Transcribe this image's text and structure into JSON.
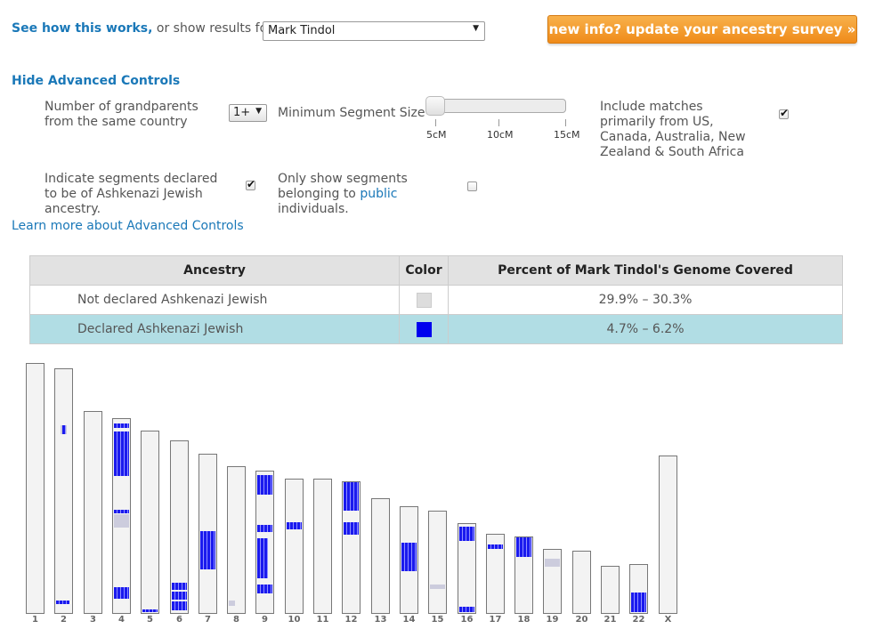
{
  "header": {
    "see_how": "See how this works,",
    "or_text": " or show results for",
    "selected_person": "Mark Tindol",
    "update_button": "new info? update your ancestry survey »"
  },
  "controls": {
    "hide_link": "Hide Advanced Controls",
    "grandparents_label": "Number of grandparents from the same country",
    "grandparents_value": "1+",
    "min_segment_label": "Minimum Segment Size",
    "slider_labels": [
      "5cM",
      "10cM",
      "15cM"
    ],
    "slider_value_cM": 5,
    "include_matches_label": "Include matches primarily from US, Canada, Australia, New Zealand & South Africa",
    "include_matches_checked": true,
    "ashkenazi_label": "Indicate segments declared to be of Ashkenazi Jewish ancestry.",
    "ashkenazi_checked": true,
    "public_label_pre": "Only show segments belonging to ",
    "public_link": "public",
    "public_label_post": " individuals.",
    "public_checked": false,
    "learn_more": "Learn more about Advanced Controls"
  },
  "table": {
    "headers": [
      "Ancestry",
      "Color",
      "Percent of Mark Tindol's Genome Covered"
    ],
    "rows": [
      {
        "ancestry": "Not declared Ashkenazi Jewish",
        "color": "#dddddd",
        "percent": "29.9% –  30.3%"
      },
      {
        "ancestry": "Declared Ashkenazi Jewish",
        "color": "#0000ee",
        "percent": "4.7% –   6.2%"
      }
    ]
  },
  "colors": {
    "segment": "#1a1aee",
    "segment_light": "#ccccdd",
    "accent": "#f5a623",
    "link": "#1a78b8"
  },
  "chromosomes": {
    "labels": [
      "1",
      "2",
      "3",
      "4",
      "5",
      "6",
      "7",
      "8",
      "9",
      "10",
      "11",
      "12",
      "13",
      "14",
      "15",
      "16",
      "17",
      "18",
      "19",
      "20",
      "21",
      "22",
      "X"
    ],
    "relative_lengths": [
      1.0,
      0.98,
      0.81,
      0.78,
      0.73,
      0.69,
      0.64,
      0.59,
      0.57,
      0.54,
      0.54,
      0.53,
      0.46,
      0.43,
      0.41,
      0.36,
      0.32,
      0.31,
      0.26,
      0.25,
      0.19,
      0.2,
      0.63
    ]
  }
}
